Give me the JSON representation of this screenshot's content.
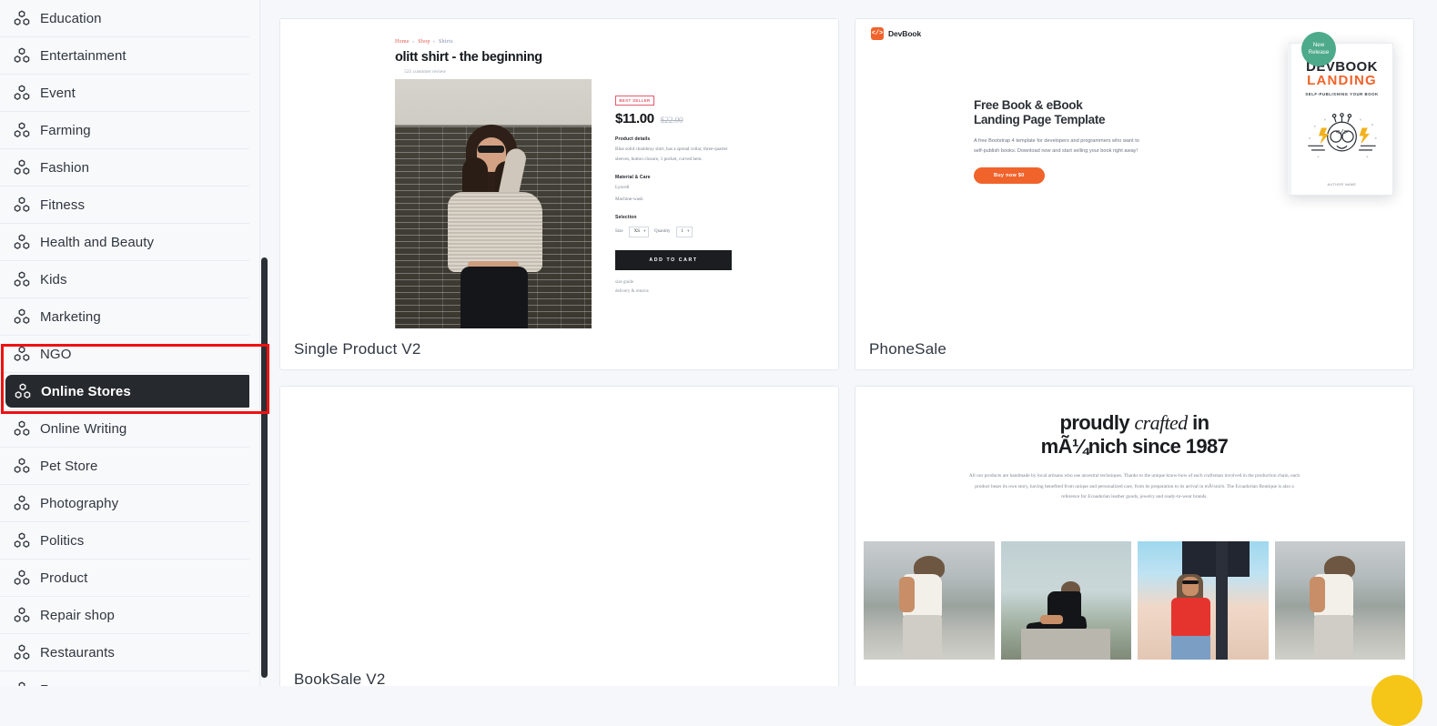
{
  "sidebar": {
    "icon": "boxes-icon",
    "items": [
      {
        "label": "Education",
        "active": false
      },
      {
        "label": "Entertainment",
        "active": false
      },
      {
        "label": "Event",
        "active": false
      },
      {
        "label": "Farming",
        "active": false
      },
      {
        "label": "Fashion",
        "active": false
      },
      {
        "label": "Fitness",
        "active": false
      },
      {
        "label": "Health and Beauty",
        "active": false
      },
      {
        "label": "Kids",
        "active": false
      },
      {
        "label": "Marketing",
        "active": false
      },
      {
        "label": "NGO",
        "active": false
      },
      {
        "label": "Online Stores",
        "active": true
      },
      {
        "label": "Online Writing",
        "active": false
      },
      {
        "label": "Pet Store",
        "active": false
      },
      {
        "label": "Photography",
        "active": false
      },
      {
        "label": "Politics",
        "active": false
      },
      {
        "label": "Product",
        "active": false
      },
      {
        "label": "Repair shop",
        "active": false
      },
      {
        "label": "Restaurants",
        "active": false
      },
      {
        "label": "Resume",
        "active": false
      }
    ],
    "highlight": {
      "target": "Online Stores",
      "color": "#ee1111"
    }
  },
  "cards": [
    {
      "title": "Single Product V2",
      "preview": {
        "breadcrumb": {
          "home": "Home",
          "shop": "Shop",
          "category": "Shirts",
          "separator": "»"
        },
        "product_title": "olitt shirt - the beginning",
        "review_count": "525 customer review",
        "badge": "Best Seller",
        "price": "$11.00",
        "old_price": "$22.00",
        "details_heading": "Product details",
        "details_text": "Blue solid chambray shirt, has a spread collar, three-quarter sleeves, button closure, 1 pocket, curved hem.",
        "material_heading": "Material & Care",
        "material_lines": [
          "Lyocell",
          "Machine-wash"
        ],
        "selection_heading": "Selection",
        "size_label": "Size",
        "size_value": "XS",
        "quantity_label": "Quantity",
        "quantity_value": "1",
        "cart_button": "ADD TO CART",
        "links": [
          "size guide",
          "delivery & returns"
        ]
      }
    },
    {
      "title": "PhoneSale",
      "preview": {
        "logo_mark": "</>",
        "logo_text": "DevBook",
        "heading_line1": "Free Book & eBook",
        "heading_line2": "Landing Page Template",
        "paragraph": "A free Bootstrap 4 template for developers and programmers who want to self-publish books. Download now and start selling your book right away!",
        "cta": "Buy now  $0",
        "badge_line1": "New",
        "badge_line2": "Release",
        "badge_color": "#4daa8a",
        "accent_color": "#f0632b",
        "book": {
          "title_line1": "DEVBOOK",
          "title_line2": "LANDING",
          "subtitle": "SELF-PUBLISHING YOUR BOOK",
          "author": "AUTHOR NAME"
        }
      }
    },
    {
      "title": "BookSale V2",
      "preview": {}
    },
    {
      "title": "",
      "preview": {
        "heading_part1": "proudly ",
        "heading_italic": "crafted",
        "heading_part2": " in",
        "heading_line2": "mÃ¼nich since 1987",
        "paragraph": "All our products are handmade by local artisans who use ancestral techniques. Thanks to the unique know-how of each craftsman involved in the production chain, each product bears its own story, having benefited from unique and personalized care, from its preparation to its arrival in mÃ¼nich. The Ecuadorian Boutique is also a reference for Ecuadorian leather goods, jewelry and ready-to-wear brands.",
        "gallery_alt": [
          "woman in white top by the lake",
          "woman in black sitting on ledge",
          "woman in red infuse tee",
          "woman in white top by the lake"
        ]
      }
    }
  ],
  "chat_fab": {
    "name": "chat-support-button",
    "color": "#f5c518"
  }
}
